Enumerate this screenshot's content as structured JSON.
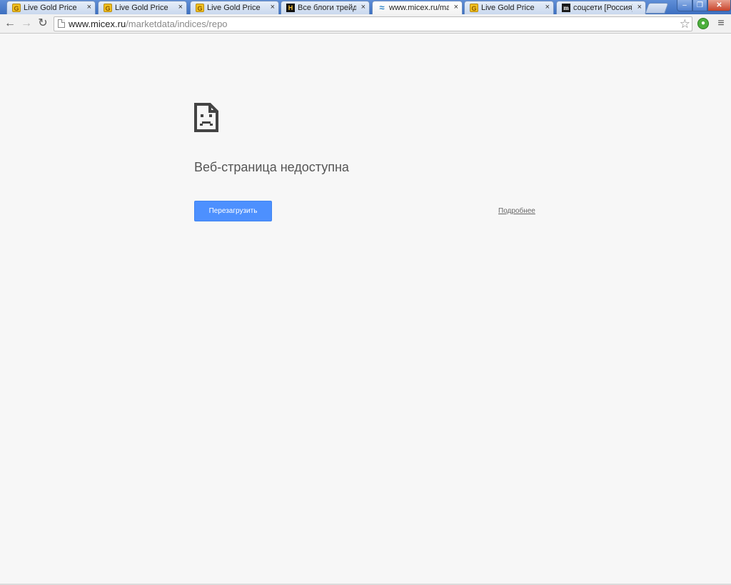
{
  "tabs": [
    {
      "title": "Live Gold Price",
      "favicon": "gold-price-favicon",
      "active": false
    },
    {
      "title": "Live Gold Price",
      "favicon": "gold-price-favicon",
      "active": false
    },
    {
      "title": "Live Gold Price",
      "favicon": "gold-price-favicon",
      "active": false
    },
    {
      "title": "Все блоги трейдер",
      "favicon": "blog-favicon",
      "active": false
    },
    {
      "title": "www.micex.ru/mar",
      "favicon": "micex-favicon",
      "active": true
    },
    {
      "title": "Live Gold Price",
      "favicon": "gold-price-favicon",
      "active": false
    },
    {
      "title": "соцсети [Россия]",
      "favicon": "m-favicon",
      "active": false
    }
  ],
  "tab_close_glyph": "×",
  "window_controls": {
    "minimize": "–",
    "maximize": "❐",
    "close": "✕"
  },
  "toolbar": {
    "back_glyph": "←",
    "forward_glyph": "→",
    "reload_glyph": "↻",
    "url_host": "www.micex.ru",
    "url_path": "/marketdata/indices/repo",
    "star_glyph": "☆",
    "menu_glyph": "≡"
  },
  "error": {
    "title": "Веб-страница недоступна",
    "reload_label": "Перезагрузить",
    "details_label": "Подробнее"
  },
  "colors": {
    "reload_button": "#4d90fe",
    "page_background": "#f7f7f7"
  }
}
